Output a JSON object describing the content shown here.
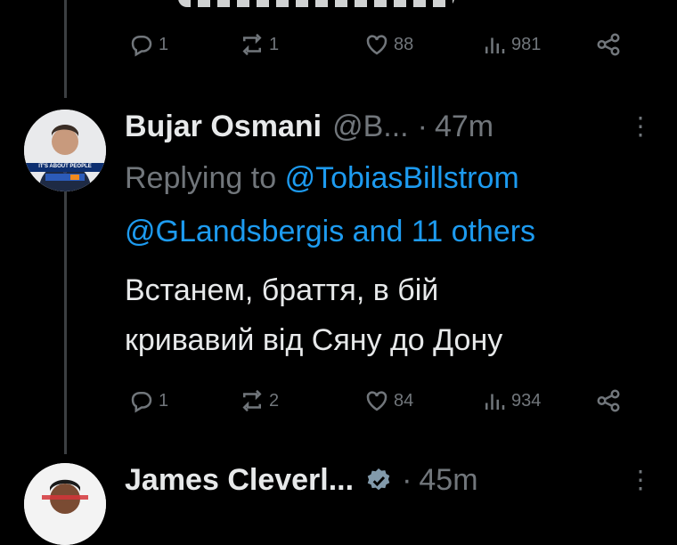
{
  "tweet0": {
    "actions": {
      "replies": "1",
      "retweets": "1",
      "likes": "88",
      "views": "981"
    }
  },
  "tweet1": {
    "name": "Bujar Osmani",
    "handle": "@B...",
    "dot": "·",
    "time": "47m",
    "avatar_banner": "IT'S ABOUT PEOPLE",
    "replying_prefix": "Replying to",
    "reply_to_1": "@TobiasBillstrom",
    "reply_to_2": "@GLandsbergis and 11 others",
    "body_line1": "Встанем, браття, в бій",
    "body_line2": "кривавий від Сяну до Дону",
    "actions": {
      "replies": "1",
      "retweets": "2",
      "likes": "84",
      "views": "934"
    }
  },
  "tweet2": {
    "name": "James Cleverl...",
    "dot": "·",
    "time": "45m"
  },
  "colors": {
    "background": "#000000",
    "link": "#1d9bf0",
    "muted": "#71767b",
    "text": "#e7e9ea",
    "verified": "#829aab"
  }
}
